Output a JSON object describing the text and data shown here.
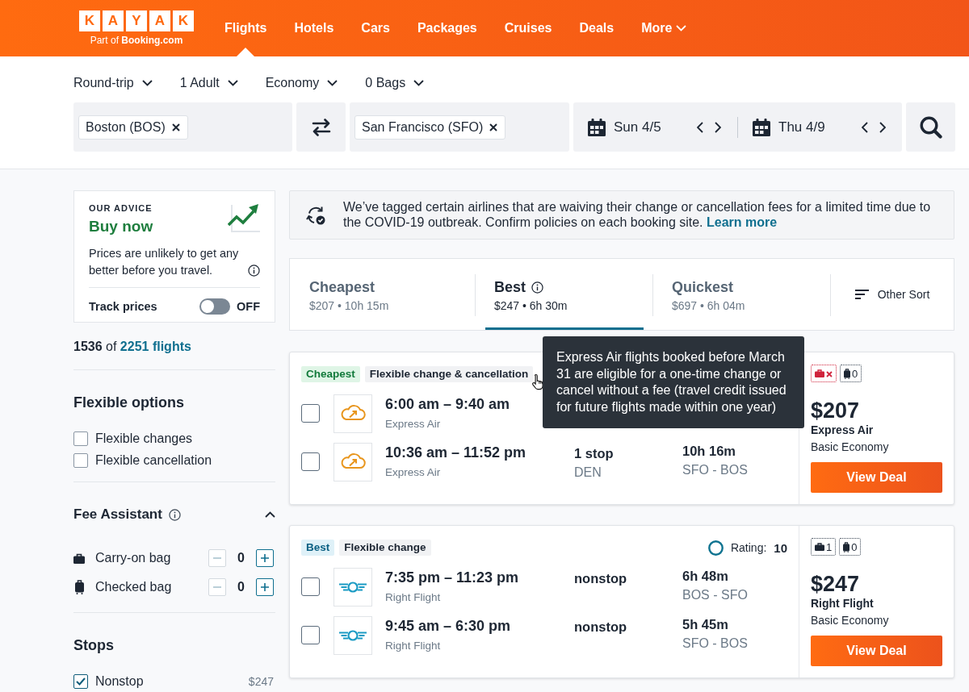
{
  "header": {
    "logo": {
      "letters": [
        "K",
        "A",
        "Y",
        "A",
        "K"
      ],
      "tagline": "Part of **Booking.com**"
    },
    "nav": [
      {
        "label": "Flights",
        "kind": "link",
        "selected": true
      },
      {
        "label": "Hotels",
        "kind": "link",
        "selected": false
      },
      {
        "label": "Cars",
        "kind": "link",
        "selected": false
      },
      {
        "label": "Packages",
        "kind": "link",
        "selected": false
      },
      {
        "label": "Cruises",
        "kind": "link",
        "selected": false
      },
      {
        "label": "Deals",
        "kind": "link",
        "selected": false
      },
      {
        "label": "More",
        "kind": "menu",
        "selected": false
      }
    ]
  },
  "search": {
    "options": [
      "Round-trip",
      "1 Adult",
      "Economy",
      "0 Bags"
    ],
    "origin": {
      "value": "Boston (BOS)"
    },
    "destination": {
      "value": "San Francisco (SFO)"
    },
    "dates": [
      {
        "value": "Sun 4/5"
      },
      {
        "value": "Thu 4/9"
      }
    ]
  },
  "sidebar": {
    "advice": {
      "eyebrow": "OUR ADVICE",
      "verdict": "Buy now",
      "text": "Prices are unlikely to get any better before you travel.",
      "track": {
        "label": "Track prices",
        "on": false,
        "state": "OFF"
      }
    },
    "summary": {
      "text": "**1536** of",
      "link": "2251 flights"
    },
    "filters": [
      {
        "kind": "checkboxes",
        "title": "Flexible options",
        "items": [
          {
            "label": "Flexible changes",
            "checked": false
          },
          {
            "label": "Flexible cancellation",
            "checked": false
          }
        ]
      },
      {
        "kind": "counters",
        "title": "Fee Assistant",
        "info": true,
        "expanded": true,
        "items": [
          {
            "label": "Carry-on bag",
            "kind": "carry-on",
            "value": "0",
            "decrement_disabled": true
          },
          {
            "label": "Checked bag",
            "kind": "checked",
            "value": "0",
            "decrement_disabled": true
          }
        ]
      },
      {
        "kind": "checkboxes",
        "title": "Stops",
        "items": [
          {
            "label": "Nonstop",
            "checked": true,
            "price": "$247"
          }
        ]
      }
    ]
  },
  "main": {
    "notice": {
      "text": "We’ve tagged certain airlines that are waiving their change or cancellation fees for a limited time due to the COVID-19 outbreak. Confirm policies on each booking site.",
      "link": "Learn more"
    },
    "sort_tabs": [
      {
        "label": "Cheapest",
        "detail": "$207 • 10h 15m",
        "selected": false
      },
      {
        "label": "Best",
        "detail": "$247 • 6h 30m",
        "selected": true,
        "info": true
      },
      {
        "label": "Quickest",
        "detail": "$697 • 6h 04m",
        "selected": false
      }
    ],
    "other_sort": {
      "label": "Other Sort"
    },
    "results": [
      {
        "tags": [
          {
            "label": "Cheapest",
            "kind": "cheapest"
          },
          {
            "label": "Flexible change & cancellation",
            "kind": "flex"
          }
        ],
        "tooltip": {
          "text": "Express Air flights booked before March 31 are eligible for a one-time change or cancel without a fee (travel credit issued for future flights made within one year)"
        },
        "legs": [
          {
            "checked": false,
            "kind": "cloud",
            "times": "6:00 am – 9:40 am",
            "airline": "Express Air"
          },
          {
            "checked": false,
            "kind": "cloud",
            "times": "10:36 am – 11:52 pm",
            "airline": "Express Air",
            "stops": "1 stop",
            "stop_detail": "DEN",
            "duration": "10h 16m",
            "route": "SFO - BOS"
          }
        ],
        "bags": [
          {
            "kind": "carry-on",
            "allowed": false
          },
          {
            "kind": "checked",
            "allowed": true,
            "count": "0"
          }
        ],
        "price": "$207",
        "airline": "Express Air",
        "fare": "Basic Economy",
        "button": "View Deal"
      },
      {
        "tags": [
          {
            "label": "Best",
            "kind": "best"
          },
          {
            "label": "Flexible change",
            "kind": "flex"
          }
        ],
        "rating": {
          "label": "Rating:",
          "value": "10"
        },
        "legs": [
          {
            "checked": false,
            "kind": "wings",
            "times": "7:35 pm – 11:23 pm",
            "airline": "Right Flight",
            "stops": "nonstop",
            "duration": "6h 48m",
            "route": "BOS - SFO"
          },
          {
            "checked": false,
            "kind": "wings",
            "times": "9:45 am – 6:30 pm",
            "airline": "Right Flight",
            "stops": "nonstop",
            "duration": "5h 45m",
            "route": "SFO - BOS"
          }
        ],
        "bags": [
          {
            "kind": "carry-on",
            "allowed": true,
            "count": "1"
          },
          {
            "kind": "checked",
            "allowed": true,
            "count": "0"
          }
        ],
        "price": "$247",
        "airline": "Right Flight",
        "fare": "Basic Economy",
        "button": "View Deal"
      }
    ]
  }
}
